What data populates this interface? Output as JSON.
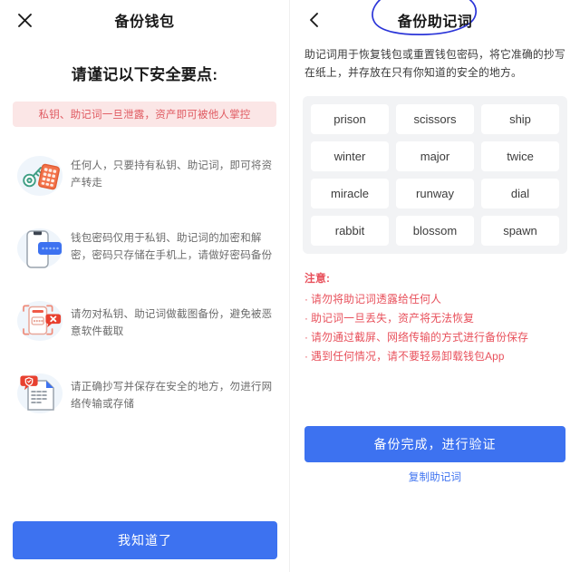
{
  "left": {
    "nav": {
      "close_icon": "close-icon",
      "title": "备份钱包"
    },
    "lead_title": "请谨记以下安全要点:",
    "alert": "私钥、助记词一旦泄露，资产即可被他人掌控",
    "tips": [
      {
        "icon": "key-keypad-icon",
        "text": "任何人，只要持有私钥、助记词，即可将资产转走"
      },
      {
        "icon": "phone-password-icon",
        "text": "钱包密码仅用于私钥、助记词的加密和解密，密码只存储在手机上，请做好密码备份"
      },
      {
        "icon": "no-screenshot-icon",
        "text": "请勿对私钥、助记词做截图备份，避免被恶意软件截取"
      },
      {
        "icon": "document-shield-icon",
        "text": "请正确抄写并保存在安全的地方，勿进行网络传输或存储"
      }
    ],
    "know_button": "我知道了"
  },
  "right": {
    "nav": {
      "back_icon": "chevron-left-icon",
      "title": "备份助记词",
      "annotation_icon": "blue-circle-annotation"
    },
    "description": "助记词用于恢复钱包或重置钱包密码，将它准确的抄写在纸上，并存放在只有你知道的安全的地方。",
    "mnemonic_words": [
      "prison",
      "scissors",
      "ship",
      "winter",
      "major",
      "twice",
      "miracle",
      "runway",
      "dial",
      "rabbit",
      "blossom",
      "spawn"
    ],
    "notice_title": "注意:",
    "notice_items": [
      "请勿将助记词透露给任何人",
      "助记词一旦丢失，资产将无法恢复",
      "请勿通过截屏、网络传输的方式进行备份保存",
      "遇到任何情况，请不要轻易卸载钱包App"
    ],
    "notice_bullet": "·",
    "verify_button": "备份完成，进行验证",
    "copy_link": "复制助记词"
  },
  "colors": {
    "primary": "#3d72f0",
    "danger": "#e8505b",
    "alert_bg": "#fbe6e6",
    "card_bg": "#f2f3f5",
    "annotation": "#2b35d8"
  }
}
